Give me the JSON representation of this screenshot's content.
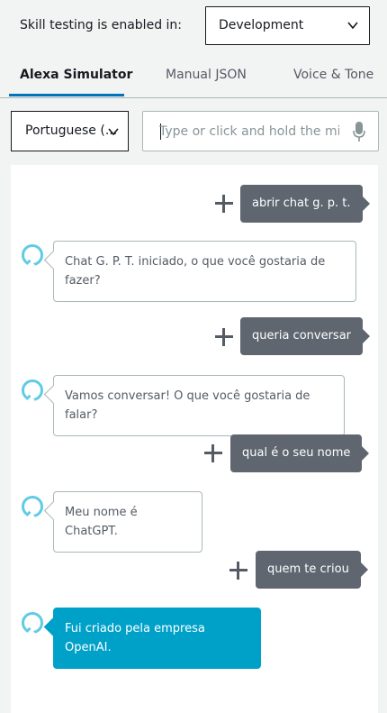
{
  "header": {
    "skill_testing_label": "Skill testing is enabled in:",
    "stage_selected": "Development"
  },
  "tabs": [
    {
      "label": "Alexa Simulator",
      "active": true
    },
    {
      "label": "Manual JSON",
      "active": false
    },
    {
      "label": "Voice & Tone",
      "active": false
    }
  ],
  "simulator": {
    "language_selected": "Portuguese (...",
    "utterance_placeholder": "Type or click and hold the mic",
    "utterance_value": ""
  },
  "conversation": [
    {
      "speaker": "user",
      "text": "abrir chat g. p. t."
    },
    {
      "speaker": "alexa",
      "text": "Chat G. P. T. iniciado, o que você gostaria de fazer?"
    },
    {
      "speaker": "user",
      "text": "queria conversar"
    },
    {
      "speaker": "alexa",
      "text": "Vamos conversar! O que você gostaria de falar?"
    },
    {
      "speaker": "user",
      "text": "qual é o seu nome"
    },
    {
      "speaker": "alexa",
      "text": "Meu nome é ChatGPT."
    },
    {
      "speaker": "user",
      "text": "quem te criou"
    },
    {
      "speaker": "alexa",
      "text": "Fui criado pela empresa OpenAI.",
      "highlighted": true
    }
  ],
  "colors": {
    "accent": "#0073bb",
    "alexa_ring": "#5fcbe5",
    "alexa_highlight": "#00a1c9",
    "user_bubble": "#5f6670"
  }
}
